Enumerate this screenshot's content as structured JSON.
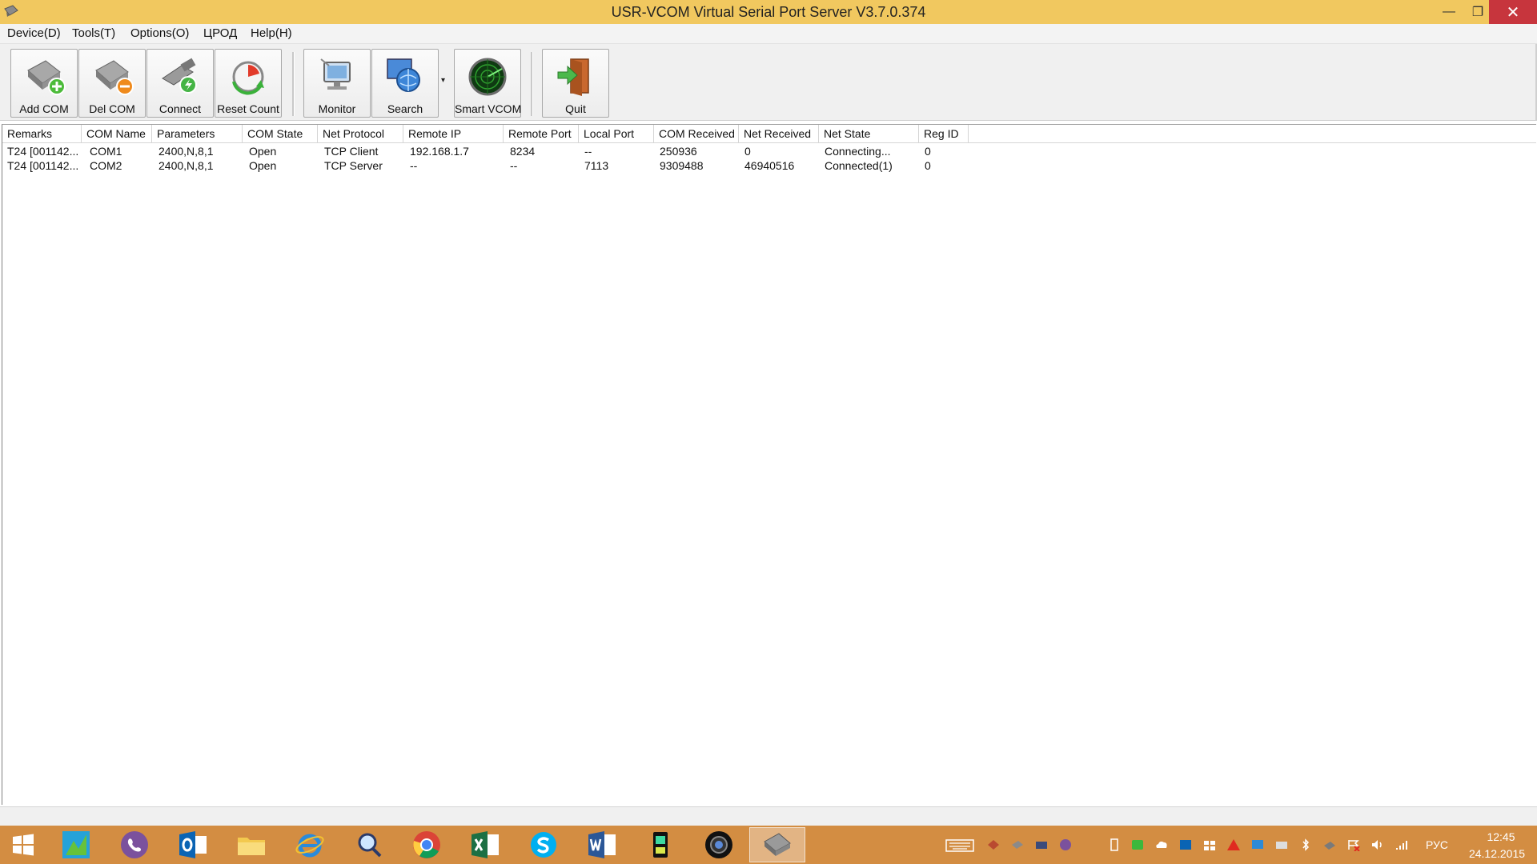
{
  "window": {
    "title": "USR-VCOM Virtual Serial Port Server V3.7.0.374",
    "minimize": "—",
    "maximize": "❐",
    "close": "✕"
  },
  "menu": [
    "Device(D)",
    "Tools(T)",
    "Options(O)",
    "ЦРОД",
    "Help(H)"
  ],
  "toolbar": {
    "add_com": "Add COM",
    "del_com": "Del COM",
    "connect": "Connect",
    "reset_count": "Reset Count",
    "monitor": "Monitor",
    "search": "Search",
    "smart_vcom": "Smart VCOM",
    "quit": "Quit",
    "dropdown_glyph": "▾"
  },
  "table": {
    "headers": [
      "Remarks",
      "COM Name",
      "Parameters",
      "COM State",
      "Net Protocol",
      "Remote IP",
      "Remote Port",
      "Local Port",
      "COM Received",
      "Net Received",
      "Net State",
      "Reg ID"
    ],
    "rows": [
      [
        "T24 [001142...",
        "COM1",
        "2400,N,8,1",
        "Open",
        "TCP Client",
        "192.168.1.7",
        "8234",
        "--",
        "250936",
        "0",
        "Connecting...",
        "0"
      ],
      [
        "T24 [001142...",
        "COM2",
        "2400,N,8,1",
        "Open",
        "TCP Server",
        "--",
        "--",
        "7113",
        "9309488",
        "46940516",
        "Connected(1)",
        "0"
      ]
    ]
  },
  "taskbar": {
    "apps": [
      "start-icon",
      "app-green-icon",
      "viber-icon",
      "outlook-icon",
      "file-explorer-icon",
      "internet-explorer-icon",
      "magnifier-icon",
      "chrome-icon",
      "excel-icon",
      "skype-icon",
      "word-icon",
      "device-icon",
      "camera-icon",
      "usr-vcom-icon"
    ],
    "language": "РУС",
    "time": "12:45",
    "date": "24.12.2015"
  },
  "colors": {
    "titlebar": "#f1c85f",
    "taskbar": "#d38d42",
    "close_button": "#c7353d"
  }
}
